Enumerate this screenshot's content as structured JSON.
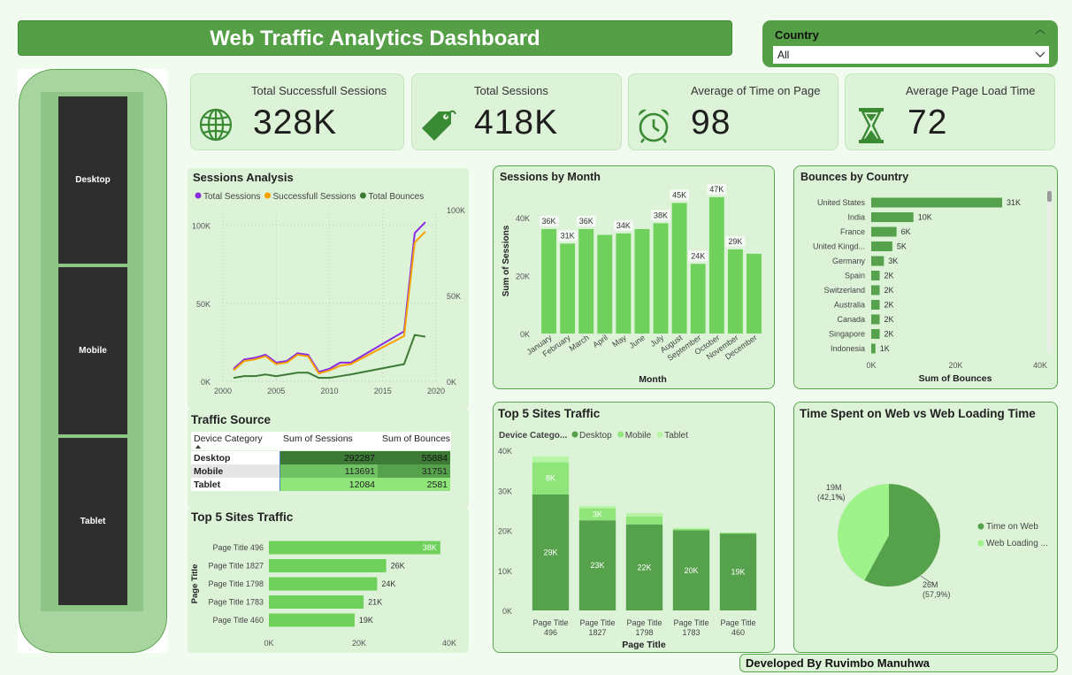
{
  "title": "Web Traffic Analytics Dashboard",
  "country_filter": {
    "label": "Country",
    "value": "All"
  },
  "kpis": [
    {
      "title": "Total Successfull Sessions",
      "value": "328K",
      "icon": "globe-icon"
    },
    {
      "title": "Total Sessions",
      "value": "418K",
      "icon": "tag-icon"
    },
    {
      "title": "Average of Time on Page",
      "value": "98",
      "icon": "alarm-clock-icon"
    },
    {
      "title": "Average Page Load Time",
      "value": "72",
      "icon": "hourglass-icon"
    }
  ],
  "device_slicer": [
    "Desktop",
    "Mobile",
    "Tablet"
  ],
  "colors": {
    "brand": "#55a047",
    "dark_green": "#3d7a36",
    "mid_green": "#56a14b",
    "light_green": "#8fe57a",
    "bar_green": "#6fd15c",
    "purple": "#8a2be2",
    "orange": "#f5a200"
  },
  "sessions_analysis": {
    "title": "Sessions Analysis",
    "legend": [
      "Total Sessions",
      "Successfull Sessions",
      "Total Bounces"
    ],
    "left_ticks": [
      "100K",
      "50K",
      "0K"
    ],
    "right_ticks": [
      "100K",
      "50K",
      "0K"
    ],
    "x_ticks": [
      "2000",
      "2005",
      "2010",
      "2015",
      "2020"
    ]
  },
  "sessions_by_month": {
    "title": "Sessions by Month",
    "y_ticks": [
      "40K",
      "20K",
      "0K"
    ],
    "ylabel": "Sum of Sessions",
    "xlabel": "Month"
  },
  "bounces_by_country": {
    "title": "Bounces by Country",
    "x_ticks": [
      "0K",
      "20K",
      "40K"
    ],
    "xlabel": "Sum of Bounces"
  },
  "traffic_source": {
    "title": "Traffic Source",
    "headers": [
      "Device Category",
      "Sum of Sessions",
      "Sum of Bounces"
    ],
    "rows": [
      {
        "device": "Desktop",
        "sessions": "292287",
        "bounces": "55884"
      },
      {
        "device": "Mobile",
        "sessions": "113691",
        "bounces": "31751"
      },
      {
        "device": "Tablet",
        "sessions": "12084",
        "bounces": "2581"
      }
    ]
  },
  "top5_hbar": {
    "title": "Top 5 Sites Traffic",
    "ylabel": "Page Title",
    "x_ticks": [
      "0K",
      "20K",
      "40K"
    ]
  },
  "top5_stacked": {
    "title": "Top 5 Sites Traffic",
    "legend_title": "Device Catego...",
    "legend": [
      "Desktop",
      "Mobile",
      "Tablet"
    ],
    "y_ticks": [
      "40K",
      "30K",
      "20K",
      "10K",
      "0K"
    ],
    "xlabel": "Page Title"
  },
  "time_vs_loading": {
    "title": "Time Spent on Web vs Web Loading Time",
    "legend": [
      "Time on Web",
      "Web Loading ..."
    ],
    "label_big": "26M",
    "label_big_pct": "(57,9%)",
    "label_small": "19M",
    "label_small_pct": "(42,1%)"
  },
  "footer": "Developed By Ruvimbo Manuhwa",
  "chart_data": [
    {
      "type": "line",
      "title": "Sessions Analysis",
      "x": [
        2001,
        2002,
        2003,
        2004,
        2005,
        2006,
        2007,
        2008,
        2009,
        2010,
        2011,
        2012,
        2017,
        2018,
        2019
      ],
      "series": [
        {
          "name": "Total Sessions",
          "axis": "left",
          "values": [
            8,
            14,
            15,
            17,
            12,
            13,
            18,
            17,
            6,
            8,
            12,
            12,
            32,
            95,
            102
          ]
        },
        {
          "name": "Successfull Sessions",
          "axis": "left",
          "values": [
            7,
            13,
            14,
            16,
            11,
            12,
            17,
            16,
            5,
            7,
            10,
            11,
            29,
            89,
            96
          ]
        },
        {
          "name": "Total Bounces",
          "axis": "right",
          "values": [
            2,
            3,
            3,
            4,
            3,
            4,
            5,
            5,
            2,
            2,
            3,
            4,
            10,
            27,
            26
          ]
        }
      ],
      "ylim_left": [
        0,
        110
      ],
      "ylim_right": [
        0,
        100
      ]
    },
    {
      "type": "bar",
      "title": "Sessions by Month",
      "categories": [
        "January",
        "February",
        "March",
        "April",
        "May",
        "June",
        "July",
        "August",
        "September",
        "October",
        "November",
        "December"
      ],
      "values": [
        36,
        31,
        36,
        34,
        34.5,
        36,
        38,
        45,
        24,
        47,
        29,
        27.5
      ],
      "labels": [
        "36K",
        "31K",
        "36K",
        "",
        "34K",
        "",
        "38K",
        "45K",
        "24K",
        "47K",
        "29K",
        ""
      ],
      "ylim": [
        0,
        50
      ]
    },
    {
      "type": "bar",
      "orientation": "horizontal",
      "title": "Bounces by Country",
      "categories": [
        "United States",
        "India",
        "France",
        "United Kingd...",
        "Germany",
        "Spain",
        "Switzerland",
        "Australia",
        "Canada",
        "Singapore",
        "Indonesia"
      ],
      "values": [
        31,
        10,
        6,
        5,
        3,
        2,
        2,
        2,
        2,
        2,
        1
      ],
      "labels": [
        "31K",
        "10K",
        "6K",
        "5K",
        "3K",
        "2K",
        "2K",
        "2K",
        "2K",
        "2K",
        "1K"
      ],
      "xlim": [
        0,
        40
      ]
    },
    {
      "type": "bar",
      "orientation": "horizontal",
      "title": "Top 5 Sites Traffic",
      "categories": [
        "Page Title 496",
        "Page Title 1827",
        "Page Title 1798",
        "Page Title 1783",
        "Page Title 460"
      ],
      "values": [
        38,
        26,
        24,
        21,
        19
      ],
      "labels": [
        "38K",
        "26K",
        "24K",
        "21K",
        "19K"
      ],
      "xlim": [
        0,
        40
      ]
    },
    {
      "type": "bar",
      "stacked": true,
      "title": "Top 5 Sites Traffic",
      "categories": [
        [
          "Page Title",
          "496"
        ],
        [
          "Page Title",
          "1827"
        ],
        [
          "Page Title",
          "1798"
        ],
        [
          "Page Title",
          "1783"
        ],
        [
          "Page Title",
          "460"
        ]
      ],
      "series": [
        {
          "name": "Desktop",
          "values": [
            29,
            22.5,
            21.5,
            20,
            19.2
          ],
          "labels": [
            "29K",
            "23K",
            "22K",
            "20K",
            "19K"
          ]
        },
        {
          "name": "Mobile",
          "values": [
            8,
            3,
            2,
            0.4,
            0.2
          ],
          "labels": [
            "8K",
            "3K",
            "",
            "",
            ""
          ]
        },
        {
          "name": "Tablet",
          "values": [
            1.5,
            0.6,
            0.8,
            0.2,
            0.1
          ],
          "labels": [
            "",
            "",
            "",
            "",
            ""
          ]
        }
      ],
      "ylim": [
        0,
        40
      ]
    },
    {
      "type": "pie",
      "title": "Time Spent on Web vs Web Loading Time",
      "categories": [
        "Time on Web",
        "Web Loading ..."
      ],
      "values": [
        57.9,
        42.1
      ]
    }
  ]
}
